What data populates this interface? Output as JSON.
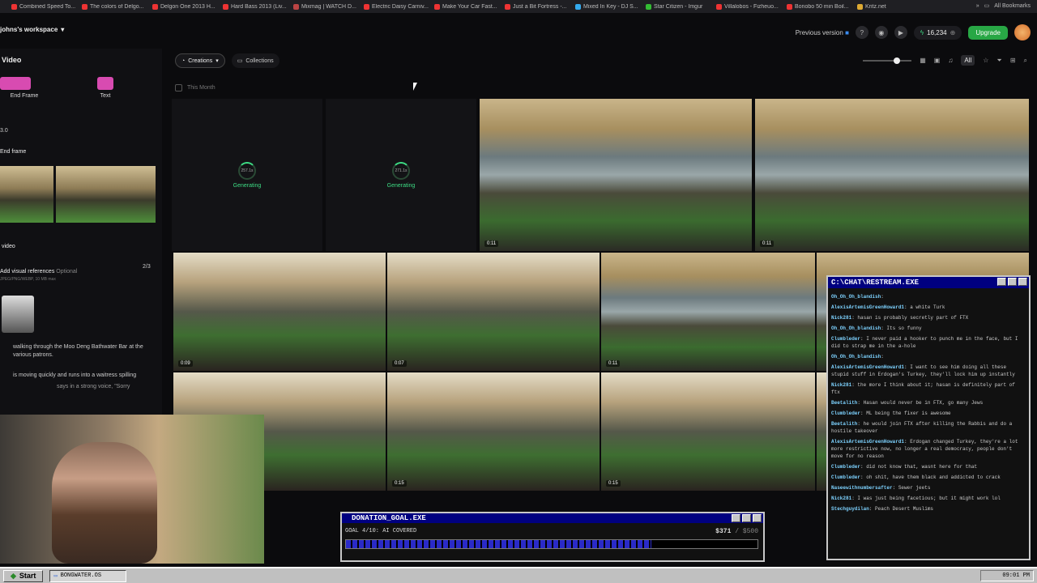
{
  "bookmarks": [
    {
      "label": "Combined Speed To...",
      "color": "#e33"
    },
    {
      "label": "The colors of Delgo...",
      "color": "#e33"
    },
    {
      "label": "Delgon One 2013 H...",
      "color": "#e33"
    },
    {
      "label": "Hard Bass 2013 (Liv...",
      "color": "#e33"
    },
    {
      "label": "Mixmag | WATCH D...",
      "color": "#b44"
    },
    {
      "label": "Electric Daisy Carniv...",
      "color": "#e33"
    },
    {
      "label": "Make Your Car Fast...",
      "color": "#e33"
    },
    {
      "label": "Just a Bit Fortress -...",
      "color": "#e33"
    },
    {
      "label": "Mixed In Key - DJ S...",
      "color": "#3ae"
    },
    {
      "label": "Star Citizen - Imgur",
      "color": "#3b3"
    },
    {
      "label": "Villalobos - Fizheuo...",
      "color": "#e33"
    },
    {
      "label": "Bonobo 50 min Boil...",
      "color": "#e33"
    },
    {
      "label": "Kritz.net",
      "color": "#da3"
    }
  ],
  "all_bookmarks": "All Bookmarks",
  "workspace": "johns's workspace",
  "previous_version": "Previous version",
  "credits": "16,234",
  "upgrade": "Upgrade",
  "sidebar": {
    "title": "Video",
    "mode_frame": "End Frame",
    "mode_text": "Text",
    "version": "3.0",
    "end_frame": "End frame",
    "video": "video",
    "add_refs": "Add visual references",
    "optional": "Optional",
    "formats": "JPEG/PNG/WEBP, 10 MB max",
    "count": "2/3",
    "prompt1": "walking through the Moo Deng Bathwater Bar at the various patrons.",
    "prompt2": "is moving quickly and runs into a waitress spilling",
    "prompt3": "says in a strong voice, \"Sorry"
  },
  "main": {
    "tab_creations": "Creations",
    "tab_collections": "Collections",
    "this_month": "This Month",
    "tool_all": "All",
    "gen1_pct": "257.1s",
    "gen2_pct": "271.1s",
    "generating": "Generating",
    "dur_a": "0:11",
    "dur_b": "0:11",
    "dur_c": "0:09",
    "dur_d": "0:07",
    "dur_e": "0:11",
    "dur_f": "0:15",
    "dur_g": "0:15"
  },
  "chat": {
    "title": "C:\\CHAT\\RESTREAM.EXE",
    "messages": [
      {
        "user": "Oh_Oh_Oh_blandish",
        "text": ""
      },
      {
        "user": "AlexisArtemisGreenHoward1",
        "text": "a white Turk"
      },
      {
        "user": "Nick281",
        "text": "hasan is probably secretly part of FTX"
      },
      {
        "user": "Oh_Oh_Oh_blandish",
        "text": "Its so funny"
      },
      {
        "user": "Clumbleder",
        "text": "I never paid a hooker to punch me in the face, but I did to strap me in the a-hole"
      },
      {
        "user": "Oh_Oh_Oh_blandish",
        "text": ""
      },
      {
        "user": "AlexisArtemisGreenHoward1",
        "text": "I want to see him doing all these stupid stuff in Erdogan's Turkey, they'll lock him up instantly"
      },
      {
        "user": "Nick281",
        "text": "the more I think about it; hasan is definitely part of ftx"
      },
      {
        "user": "Beetalith",
        "text": "Hasan would never be in FTX, go many Jews"
      },
      {
        "user": "Clumbleder",
        "text": "ML being the fixer is awesome"
      },
      {
        "user": "Beetalith",
        "text": "he would join FTX after killing the Rabbis and do a hostile takeover"
      },
      {
        "user": "AlexisArtemisGreenHoward1",
        "text": "Erdogan changed Turkey, they're a lot more restrictive now, no longer a real democracy, people don't move for no reason"
      },
      {
        "user": "Clumbleder",
        "text": "did not know that, wasnt here for that"
      },
      {
        "user": "Clumbleder",
        "text": "oh shit, have them black and addicted to crack"
      },
      {
        "user": "Naseewithnumbersafter",
        "text": "Sewer jeets"
      },
      {
        "user": "Nick281",
        "text": "I was just being facetious; but it might work lol"
      },
      {
        "user": "Stechguydilan",
        "text": "Peach Desert Muslims"
      }
    ]
  },
  "donation": {
    "title": "DONATION_GOAL.EXE",
    "goal": "GOAL 4/10: AI COVERED",
    "current": "$371",
    "target": "/ $500",
    "progress": 0.742
  },
  "taskbar": {
    "start": "Start",
    "task": "BONGWATER.OS",
    "clock": "09:01 PM"
  }
}
